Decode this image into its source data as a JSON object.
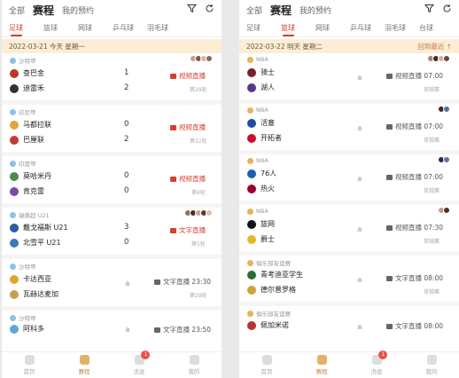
{
  "header": {
    "tabs": [
      "全部",
      "赛程",
      "我的预约"
    ],
    "active_tab": "赛程",
    "icons": [
      "filter-icon",
      "refresh-icon"
    ]
  },
  "sports_left": [
    "足球",
    "篮球",
    "网球",
    "乒乓球",
    "羽毛球"
  ],
  "sports_right": [
    "足球",
    "篮球",
    "网球",
    "乒乓球",
    "羽毛球",
    "台球"
  ],
  "left": {
    "date_bar": "2022-03-21 今天 星期一",
    "matches": [
      {
        "league": "沙特甲",
        "home": "查巴金",
        "away": "迪雷禾",
        "home_score": "1",
        "away_score": "2",
        "live": "视频直播",
        "round": "第29轮"
      },
      {
        "league": "印尼甲",
        "home": "马都拉联",
        "away": "巴厘联",
        "home_score": "0",
        "away_score": "2",
        "live": "视频直播",
        "round": "第32轮"
      },
      {
        "league": "印度甲",
        "home": "莫哈米丹",
        "away": "肯克雷",
        "home_score": "0",
        "away_score": "0",
        "live": "视频直播",
        "round": "第6轮"
      },
      {
        "league": "瑞典超 U21",
        "home": "戴戈福斯 U21",
        "away": "北雪平 U21",
        "home_score": "3",
        "away_score": "0",
        "live": "文字直播",
        "round": "第5轮"
      },
      {
        "league": "沙特甲",
        "home": "卡达西亚",
        "away": "瓦赫达麦加",
        "live": "文字直播 23:30",
        "round": "第29轮"
      },
      {
        "league": "沙特甲",
        "home": "阿科多",
        "away": "",
        "live": "文字直播 23:50",
        "round": ""
      }
    ]
  },
  "right": {
    "date_bar": "2022-03-22 明天 星期二",
    "back_today": "回到最近 ↑",
    "matches": [
      {
        "league": "NBA",
        "home": "骑士",
        "away": "湖人",
        "live": "视频直播 07:00",
        "round": "常规赛"
      },
      {
        "league": "NBA",
        "home": "活塞",
        "away": "开拓者",
        "live": "视频直播 07:00",
        "round": "常规赛"
      },
      {
        "league": "NBA",
        "home": "76人",
        "away": "热火",
        "live": "视频直播 07:00",
        "round": "常规赛"
      },
      {
        "league": "NBA",
        "home": "篮网",
        "away": "爵士",
        "live": "视频直播 07:30",
        "round": "常规赛"
      },
      {
        "league": "俱乐部友谊赛",
        "home": "青考迪亚学生",
        "away": "德尔普罗格",
        "live": "文字直播 08:00",
        "round": "常规赛"
      },
      {
        "league": "俱乐部友谊赛",
        "home": "佩加米诺",
        "away": "",
        "live": "文字直播 08:00",
        "round": ""
      }
    ]
  },
  "tabbar": {
    "items": [
      "首页",
      "赛程",
      "消息",
      "我的"
    ],
    "active": "赛程",
    "badge": "1"
  },
  "colors": {
    "accent": "#d6402f",
    "date_bar_bg": "#fbeed5",
    "gold": "#c48a45"
  }
}
